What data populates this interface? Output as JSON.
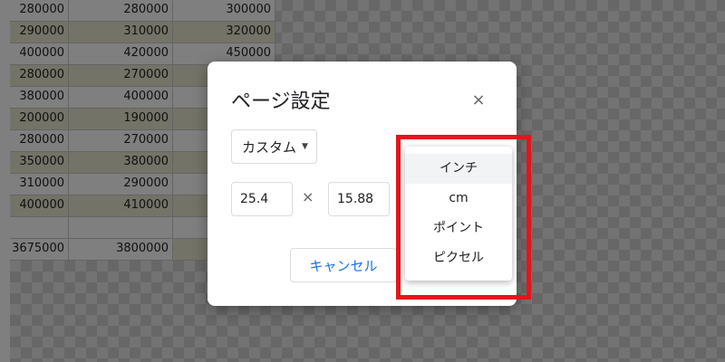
{
  "sheet": {
    "rows": [
      [
        "280000",
        "280000",
        "300000"
      ],
      [
        "290000",
        "310000",
        "320000"
      ],
      [
        "400000",
        "420000",
        "450000"
      ],
      [
        "280000",
        "270000",
        ""
      ],
      [
        "380000",
        "400000",
        ""
      ],
      [
        "200000",
        "190000",
        ""
      ],
      [
        "280000",
        "270000",
        ""
      ],
      [
        "350000",
        "380000",
        ""
      ],
      [
        "310000",
        "290000",
        ""
      ],
      [
        "400000",
        "410000",
        ""
      ],
      [
        "",
        "",
        ""
      ]
    ],
    "total": [
      "3675000",
      "3800000",
      ""
    ]
  },
  "dialog": {
    "title": "ページ設定",
    "close_icon": "×",
    "preset_label": "カスタム",
    "width_value": "25.4",
    "times_symbol": "×",
    "height_value": "15.88",
    "cancel_label": "キャンセル"
  },
  "unit_menu": {
    "items": [
      "インチ",
      "cm",
      "ポイント",
      "ピクセル"
    ]
  },
  "colors": {
    "accent": "#1a73e8",
    "highlight": "#e5141b",
    "row_alt": "#e8e6cf"
  }
}
